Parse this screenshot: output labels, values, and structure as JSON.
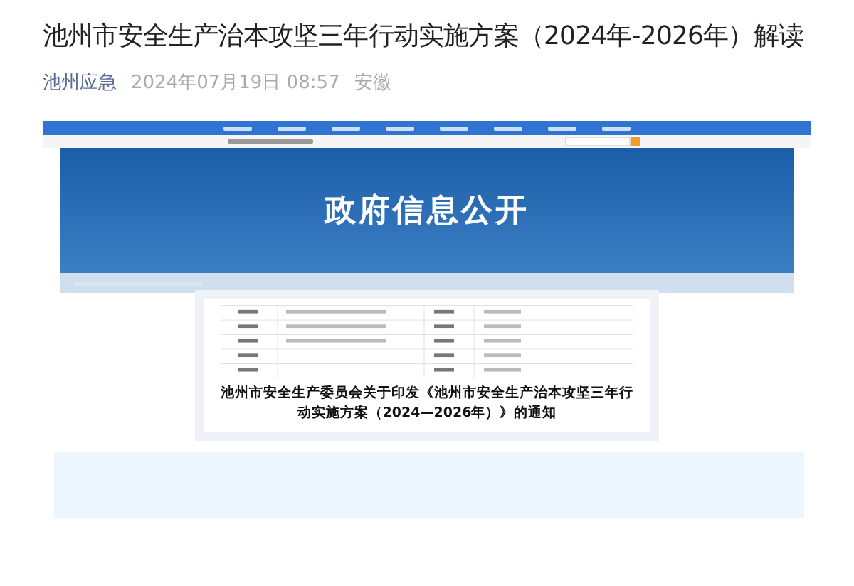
{
  "article": {
    "title": "池州市安全生产治本攻坚三年行动实施方案（2024年-2026年）解读",
    "account": "池州应急",
    "date": "2024年07月19日 08:57",
    "region": "安徽"
  },
  "embedded_page": {
    "banner_title": "政府信息公开",
    "notice_title": "池州市安全生产委员会关于印发《池州市安全生产治本攻坚三年行动实施方案（2024—2026年）》的通知"
  }
}
